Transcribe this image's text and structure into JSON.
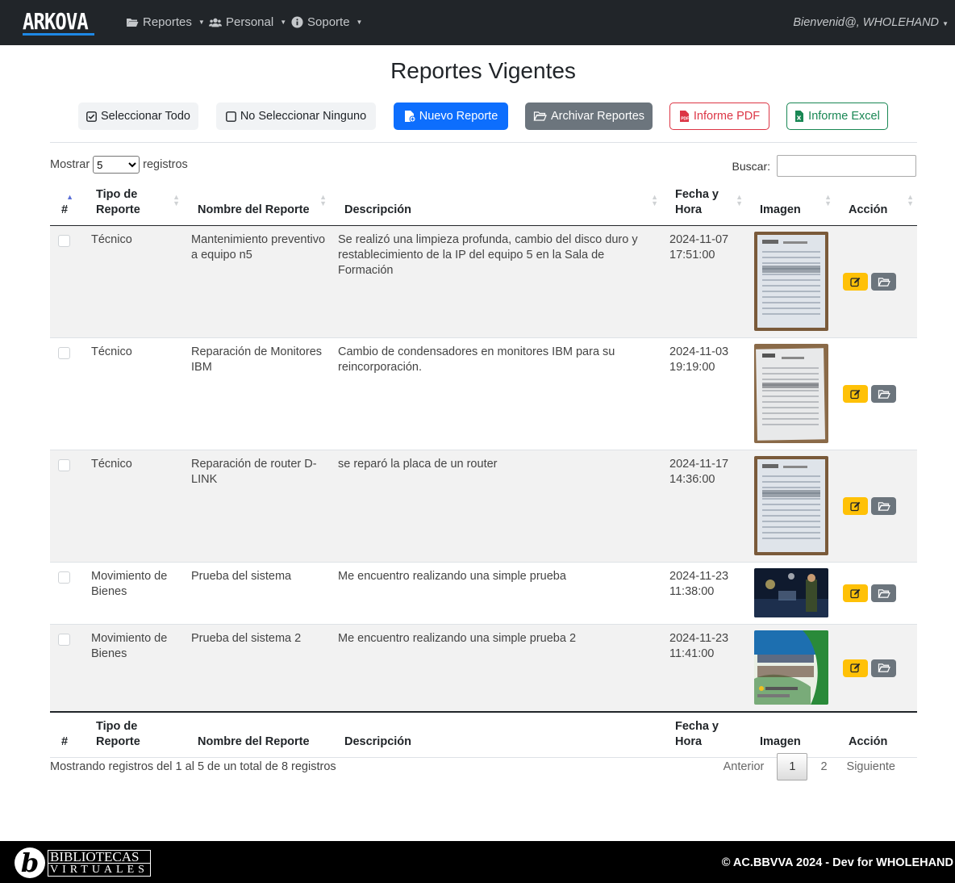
{
  "navbar": {
    "brand": "ARKOVA",
    "menus": [
      {
        "label": "Reportes",
        "icon": "folder-open-icon"
      },
      {
        "label": "Personal",
        "icon": "users-icon"
      },
      {
        "label": "Soporte",
        "icon": "info-circle-icon"
      }
    ],
    "user": "Bienvenid@, WHOLEHAND"
  },
  "page": {
    "title": "Reportes Vigentes"
  },
  "toolbar": {
    "select_all": "Seleccionar Todo",
    "select_none": "No Seleccionar Ninguno",
    "new_report": "Nuevo Reporte",
    "archive": "Archivar Reportes",
    "pdf": "Informe PDF",
    "excel": "Informe Excel"
  },
  "controls": {
    "show_prefix": "Mostrar",
    "show_value": "5",
    "show_suffix": "registros",
    "search_label": "Buscar:",
    "search_value": ""
  },
  "table": {
    "headers": {
      "num": "#",
      "tipo": "Tipo de Reporte",
      "nombre": "Nombre del Reporte",
      "descripcion": "Descripción",
      "fecha": "Fecha y Hora",
      "imagen": "Imagen",
      "accion": "Acción"
    },
    "rows": [
      {
        "tipo": "Técnico",
        "nombre": "Mantenimiento preventivo a equipo n5",
        "descripcion": "Se realizó una limpieza profunda, cambio del disco duro y restablecimiento de la IP del equipo 5 en la Sala de Formación",
        "fecha": "2024-11-07",
        "hora": "17:51:00"
      },
      {
        "tipo": "Técnico",
        "nombre": "Reparación de Monitores IBM",
        "descripcion": "Cambio de condensadores en monitores IBM para su reincorporación.",
        "fecha": "2024-11-03",
        "hora": "19:19:00"
      },
      {
        "tipo": "Técnico",
        "nombre": "Reparación de router D-LINK",
        "descripcion": "se reparó la placa de un router",
        "fecha": "2024-11-17",
        "hora": "14:36:00"
      },
      {
        "tipo": "Movimiento de Bienes",
        "nombre": "Prueba del sistema",
        "descripcion": "Me encuentro realizando una simple prueba",
        "fecha": "2024-11-23",
        "hora": "11:38:00"
      },
      {
        "tipo": "Movimiento de Bienes",
        "nombre": "Prueba del sistema 2",
        "descripcion": "Me encuentro realizando una simple prueba 2",
        "fecha": "2024-11-23",
        "hora": "11:41:00"
      }
    ]
  },
  "pagination": {
    "info": "Mostrando registros del 1 al 5 de un total de 8 registros",
    "prev": "Anterior",
    "pages": [
      "1",
      "2"
    ],
    "next": "Siguiente"
  },
  "footer": {
    "logo_line1": "BIBLIOTECAS",
    "logo_line2": "VIRTUALES",
    "copyright": "© AC.BBVVA 2024 - Dev for WHOLEHAND"
  },
  "colors": {
    "primary": "#0d6efd",
    "secondary": "#6c757d",
    "danger": "#dc3545",
    "success": "#198754",
    "warning": "#ffc107",
    "navbar": "#212529"
  }
}
